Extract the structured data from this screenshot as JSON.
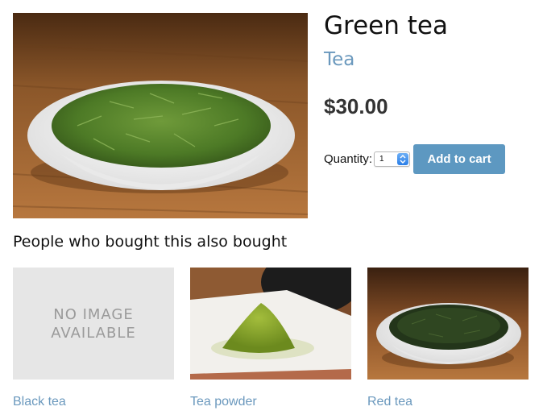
{
  "product": {
    "title": "Green tea",
    "category": "Tea",
    "price": "$30.00",
    "image_alt": "Bowl of loose green tea leaves"
  },
  "cart": {
    "quantity_label": "Quantity:",
    "quantity_value": "1",
    "add_button_label": "Add to cart"
  },
  "related": {
    "heading": "People who bought this also bought",
    "items": [
      {
        "name": "Black tea",
        "placeholder_line1": "NO IMAGE",
        "placeholder_line2": "AVAILABLE"
      },
      {
        "name": "Tea powder"
      },
      {
        "name": "Red tea"
      }
    ]
  },
  "colors": {
    "link": "#6a98bd",
    "button": "#5d98c1",
    "placeholder_bg": "#e6e6e6"
  }
}
